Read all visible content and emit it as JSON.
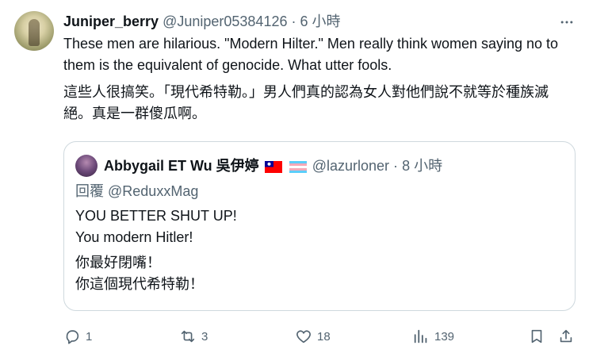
{
  "author": {
    "name": "Juniper_berry",
    "handle": "@Juniper05384126",
    "separator": "·",
    "time": "6 小時"
  },
  "post": {
    "text_en": "These men are hilarious. \"Modern Hilter.\" Men really think women saying no to them is the equivalent of genocide. What utter fools.",
    "text_zh": "這些人很搞笑。「現代希特勒。」男人們真的認為女人對他們說不就等於種族滅絕。真是一群傻瓜啊。"
  },
  "quote": {
    "name": "Abbygail ET Wu 吳伊婷",
    "handle": "@lazurloner",
    "separator": "·",
    "time": "8 小時",
    "reply_prefix": "回覆",
    "reply_to": "@ReduxxMag",
    "line1_en": "YOU BETTER SHUT UP!",
    "line2_en": "You modern Hitler!",
    "line1_zh": "你最好閉嘴！",
    "line2_zh": "你這個現代希特勒！"
  },
  "actions": {
    "replies": "1",
    "reposts": "3",
    "likes": "18",
    "views": "139"
  },
  "icons": {
    "more": "more-icon",
    "reply": "reply-icon",
    "repost": "repost-icon",
    "like": "heart-icon",
    "views": "views-icon",
    "bookmark": "bookmark-icon",
    "share": "share-icon"
  },
  "colors": {
    "text": "#0f1419",
    "secondary": "#536471",
    "border": "#cfd9de"
  }
}
